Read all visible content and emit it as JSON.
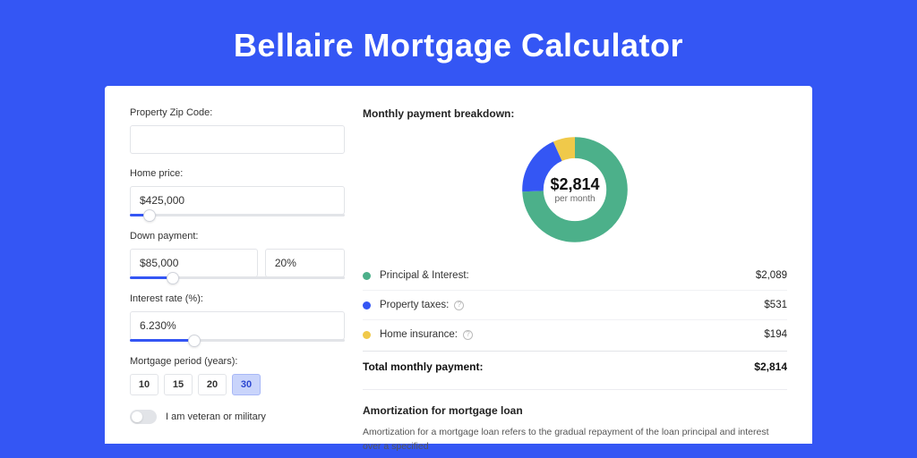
{
  "page": {
    "title": "Bellaire Mortgage Calculator"
  },
  "form": {
    "zip_label": "Property Zip Code:",
    "zip_value": "",
    "home_price_label": "Home price:",
    "home_price_value": "$425,000",
    "home_price_slider_pct": 9,
    "down_payment_label": "Down payment:",
    "down_payment_value": "$85,000",
    "down_payment_pct_value": "20%",
    "down_payment_slider_pct": 20,
    "interest_label": "Interest rate (%):",
    "interest_value": "6.230%",
    "interest_slider_pct": 30,
    "period_label": "Mortgage period (years):",
    "period_options": [
      "10",
      "15",
      "20",
      "30"
    ],
    "period_selected": "30",
    "veteran_toggle_label": "I am veteran or military",
    "veteran_toggle_on": false
  },
  "breakdown": {
    "title": "Monthly payment breakdown:",
    "center_amount": "$2,814",
    "center_sub": "per month",
    "items": [
      {
        "label": "Principal & Interest:",
        "value": "$2,089",
        "color": "#4cb08a",
        "has_info": false
      },
      {
        "label": "Property taxes:",
        "value": "$531",
        "color": "#3456f4",
        "has_info": true
      },
      {
        "label": "Home insurance:",
        "value": "$194",
        "color": "#f0c94a",
        "has_info": true
      }
    ],
    "total_label": "Total monthly payment:",
    "total_value": "$2,814"
  },
  "chart_data": {
    "type": "pie",
    "title": "Monthly payment breakdown",
    "series": [
      {
        "name": "Principal & Interest",
        "value": 2089,
        "color": "#4cb08a"
      },
      {
        "name": "Property taxes",
        "value": 531,
        "color": "#3456f4"
      },
      {
        "name": "Home insurance",
        "value": 194,
        "color": "#f0c94a"
      }
    ],
    "total": 2814,
    "inner_radius_ratio": 0.62
  },
  "amort": {
    "title": "Amortization for mortgage loan",
    "text": "Amortization for a mortgage loan refers to the gradual repayment of the loan principal and interest over a specified"
  }
}
